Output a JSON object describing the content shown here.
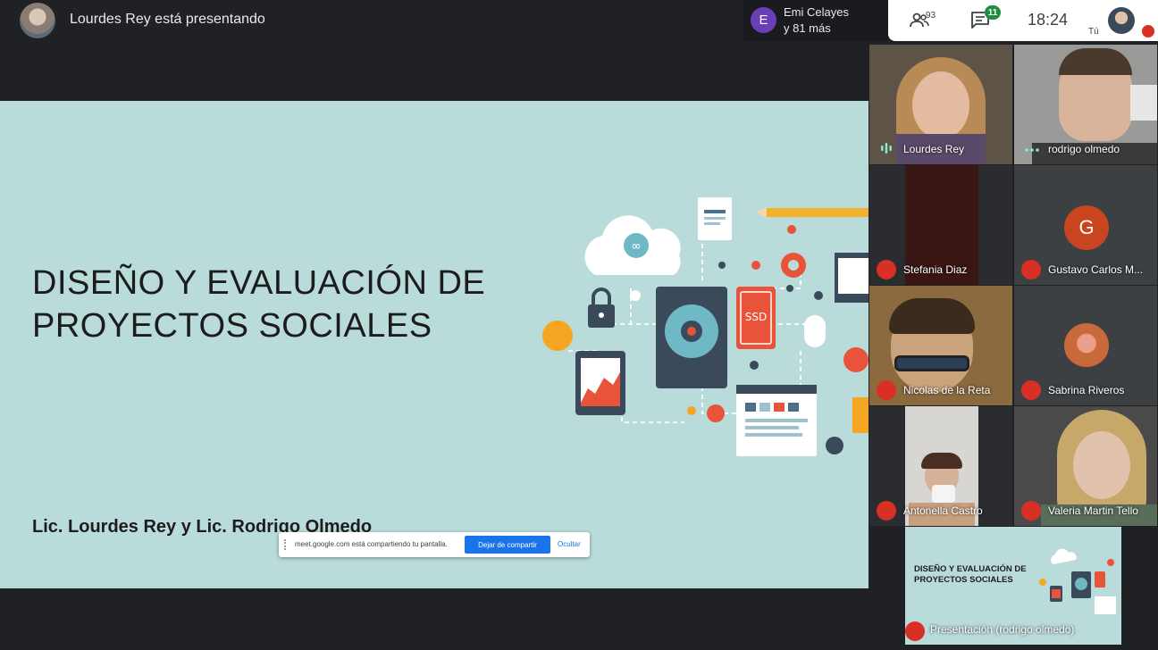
{
  "header": {
    "presenting_text": "Lourdes Rey está presentando",
    "joined": {
      "initial": "E",
      "name": "Emi Celayes",
      "more": "y 81 más"
    },
    "people_count": "93",
    "chat_badge": "11",
    "clock": "18:24",
    "self_label": "Tú"
  },
  "slide": {
    "title_line1": "DISEÑO Y EVALUACIÓN DE",
    "title_line2": "PROYECTOS SOCIALES",
    "authors": "Lic. Lourdes Rey y Lic. Rodrigo Olmedo",
    "ssd_label": "SSD"
  },
  "share_banner": {
    "text": "meet.google.com está compartiendo tu pantalla.",
    "stop_label": "Dejar de compartir",
    "hide_label": "Ocultar"
  },
  "participants": [
    {
      "name": "Lourdes Rey",
      "status": "speaking"
    },
    {
      "name": "rodrigo olmedo",
      "status": "active"
    },
    {
      "name": "Stefania Diaz",
      "status": "muted"
    },
    {
      "name": "Gustavo Carlos M...",
      "status": "muted",
      "initial": "G"
    },
    {
      "name": "Nicolas de la Reta",
      "status": "muted"
    },
    {
      "name": "Sabrina Riveros",
      "status": "muted"
    },
    {
      "name": "Antonella Castro",
      "status": "muted"
    },
    {
      "name": "Valeria Martin Tello",
      "status": "muted"
    }
  ],
  "presentation_tile": {
    "title_line1": "DISEÑO Y EVALUACIÓN DE",
    "title_line2": "PROYECTOS SOCIALES",
    "label": "Presentación (rodrigo olmedo)"
  },
  "colors": {
    "accent_blue": "#1a73e8",
    "mute_red": "#d93025",
    "slide_bg": "#b9dcda",
    "badge_green": "#1e8e3e"
  }
}
